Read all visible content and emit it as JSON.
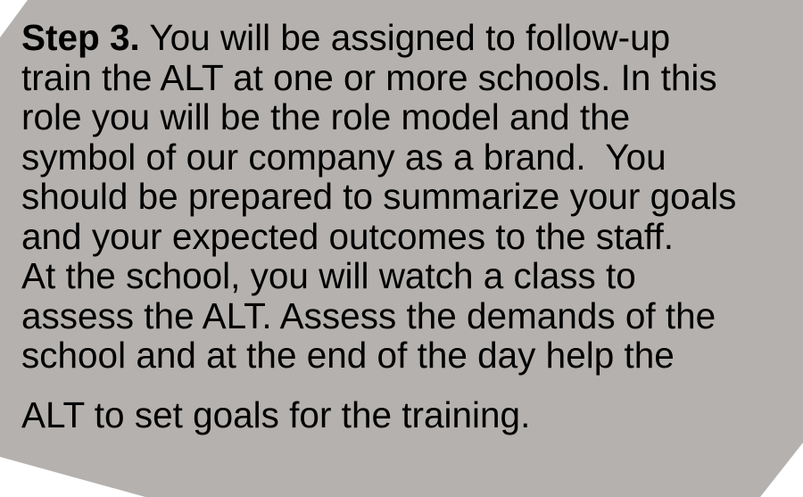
{
  "step": {
    "label": "Step 3.",
    "lines": [
      " You will be assigned to follow-up",
      "train the ALT at one or more schools. In this",
      "role you will be the role model and the",
      "symbol of our company as a brand.  You",
      "should be prepared to summarize your goals",
      "and your expected outcomes to the staff.",
      "At the school, you will watch a class to",
      "assess the ALT. Assess the demands of the",
      "school and at the end of the day help the",
      "ALT to set goals for the training."
    ]
  },
  "colors": {
    "card_background": "#b4b1ae",
    "text": "#000000"
  }
}
